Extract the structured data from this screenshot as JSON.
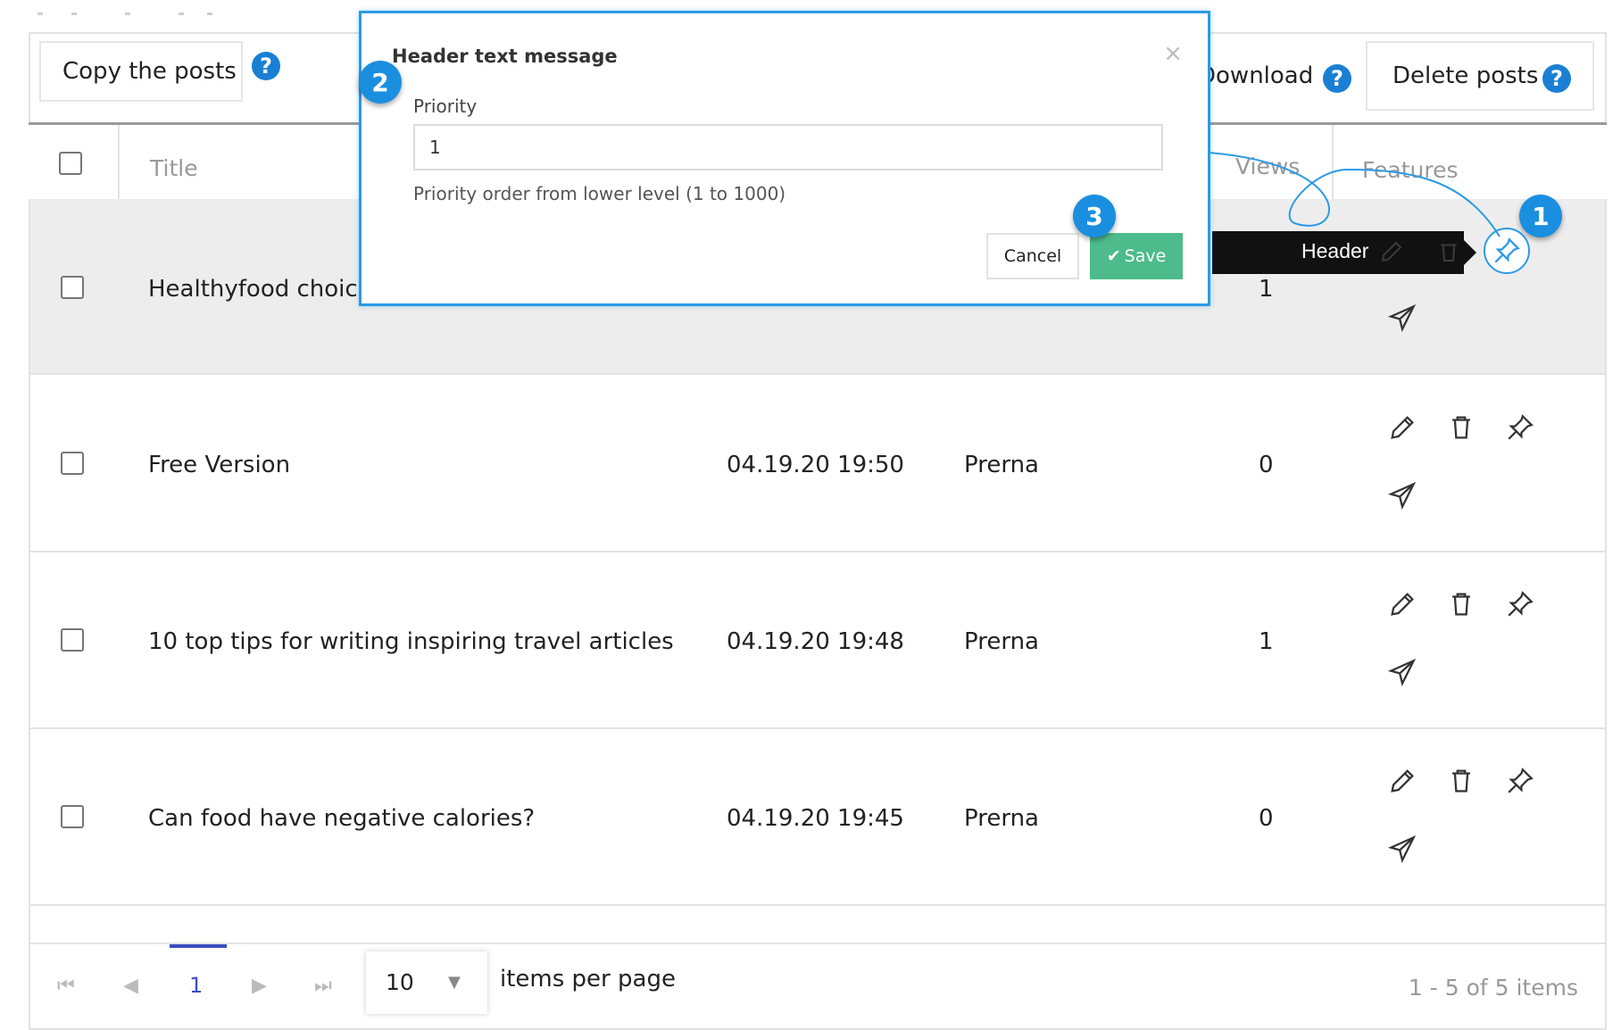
{
  "toolbar": {
    "copy_label": "Copy the posts",
    "download_label": "Download",
    "delete_label": "Delete posts"
  },
  "table": {
    "columns": {
      "title": "Title",
      "views": "Views",
      "features": "Features"
    },
    "rows": [
      {
        "title": "Healthyfood choices",
        "date": "",
        "author": "",
        "views": "1"
      },
      {
        "title": "Free Version",
        "date": "04.19.20 19:50",
        "author": "Prerna",
        "views": "0"
      },
      {
        "title": "10 top tips for writing inspiring travel articles",
        "date": "04.19.20 19:48",
        "author": "Prerna",
        "views": "1"
      },
      {
        "title": "Can food have negative calories?",
        "date": "04.19.20 19:45",
        "author": "Prerna",
        "views": "0"
      }
    ]
  },
  "tooltip": {
    "text": "Header"
  },
  "modal": {
    "title": "Header text message",
    "close": "×",
    "priority_label": "Priority",
    "priority_value": "1",
    "hint": "Priority order from lower level (1 to 1000)",
    "cancel_label": "Cancel",
    "save_label": "Save"
  },
  "badges": {
    "one": "1",
    "two": "2",
    "three": "3"
  },
  "pagination": {
    "current_page": "1",
    "page_size": "10",
    "items_per_page_label": "items per page",
    "range_text": "1 - 5 of 5 items"
  },
  "colors": {
    "accent": "#1a8fe0",
    "save": "#4dbb8c",
    "pager": "#3b4cbf"
  }
}
